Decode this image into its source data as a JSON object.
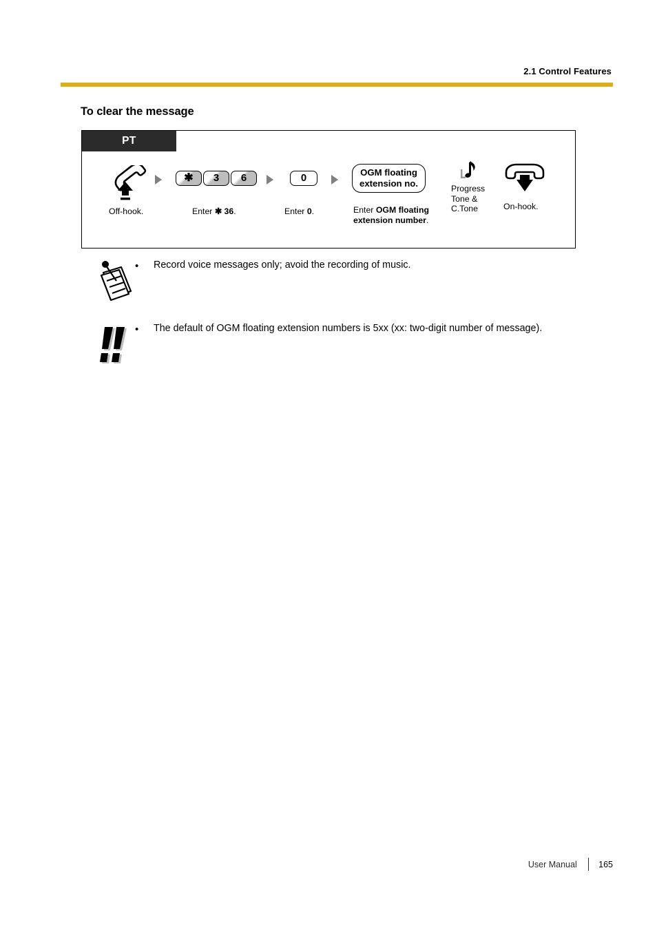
{
  "header": {
    "title": "2.1 Control Features",
    "rule_color": "#dfae10"
  },
  "section": {
    "heading": "To clear the message"
  },
  "procedure": {
    "device_tag": "PT",
    "steps": [
      {
        "kind": "hook-icon",
        "icon": "off-hook-handset-icon",
        "caption": "Off-hook."
      },
      {
        "kind": "keys",
        "keys": [
          "✱",
          "3",
          "6"
        ],
        "caption_prefix": "Enter ",
        "caption_bold": "✱ 36",
        "caption_suffix": "."
      },
      {
        "kind": "keys",
        "keys": [
          "0"
        ],
        "caption_prefix": "Enter ",
        "caption_bold": "0",
        "caption_suffix": "."
      },
      {
        "kind": "prompt",
        "prompt_line1": "OGM floating",
        "prompt_line2": "extension no.",
        "caption_prefix": "Enter ",
        "caption_bold_line1": "OGM floating",
        "caption_bold_line2": "extension number",
        "caption_suffix": "."
      },
      {
        "kind": "tone",
        "icon": "music-note-icon",
        "label_line1": "Progress",
        "label_line2": "Tone &",
        "label_line3": "C.Tone"
      },
      {
        "kind": "hook-icon",
        "icon": "on-hook-handset-icon",
        "caption": "On-hook."
      }
    ]
  },
  "notes": [
    {
      "icon": "notepad-icon",
      "bullet": "•",
      "text": "Record voice messages only; avoid the recording of music."
    },
    {
      "icon": "double-exclamation-icon",
      "bullet": "•",
      "text": "The default of OGM floating extension numbers is 5xx (xx: two-digit number of message)."
    }
  ],
  "footer": {
    "label": "User Manual",
    "page": "165"
  }
}
